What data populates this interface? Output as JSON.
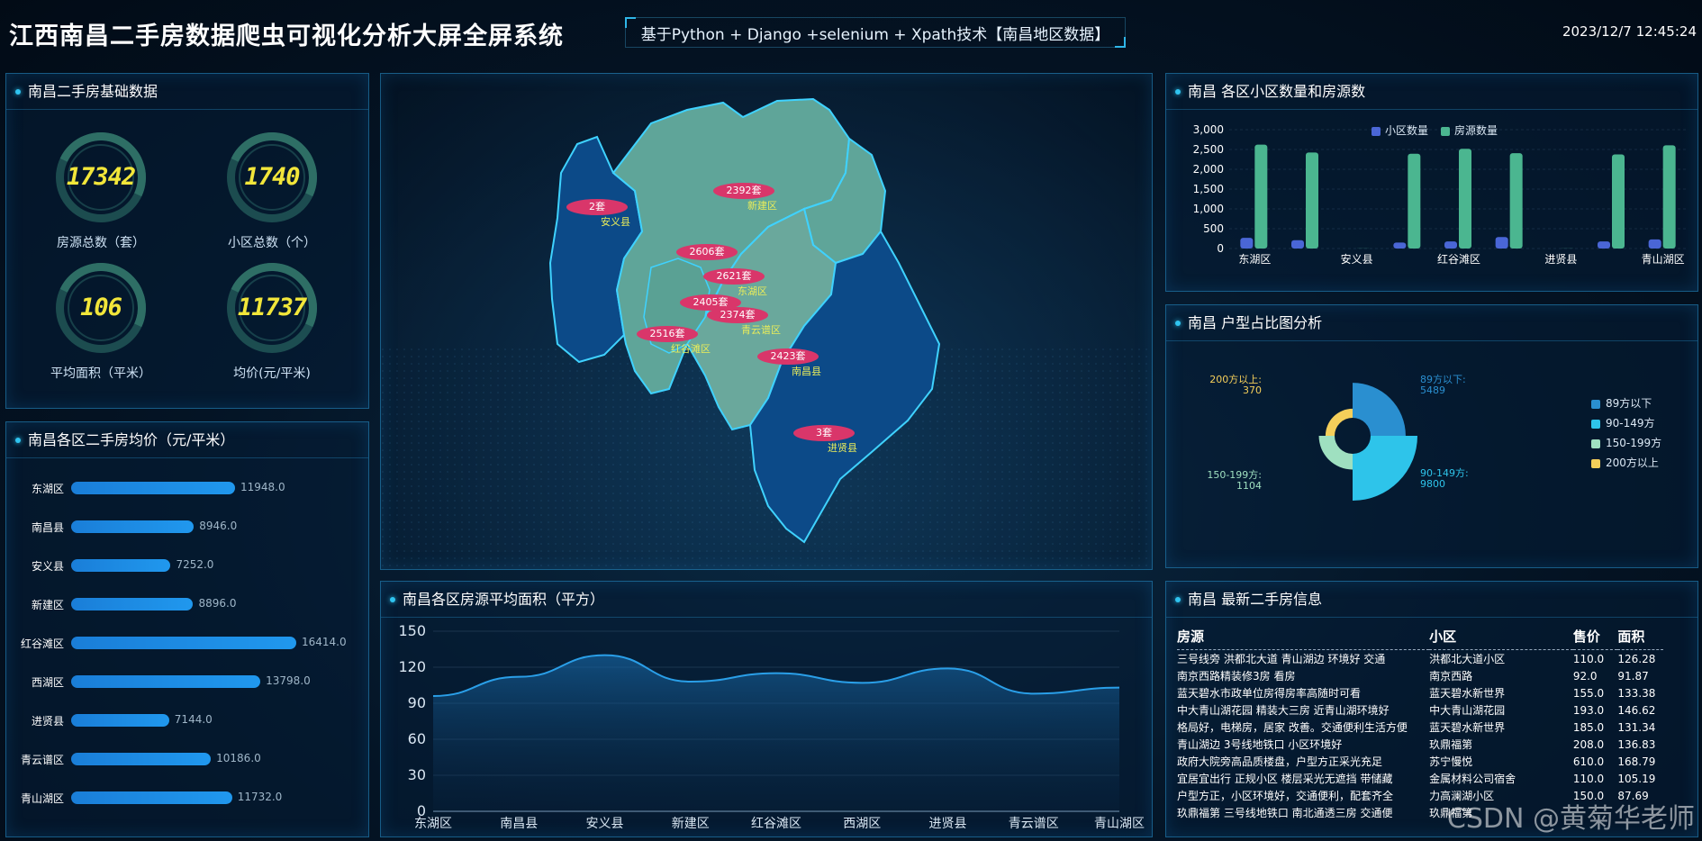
{
  "header": {
    "title": "江西南昌二手房数据爬虫可视化分析大屏全屏系统",
    "subtitle": "基于Python + Django +selenium + Xpath技术【南昌地区数据】",
    "datetime": "2023/12/7 12:45:24"
  },
  "basic": {
    "title": "南昌二手房基础数据",
    "stats": [
      {
        "value": "17342",
        "label": "房源总数（套）"
      },
      {
        "value": "1740",
        "label": "小区总数（个）"
      },
      {
        "value": "106",
        "label": "平均面积（平米）"
      },
      {
        "value": "11737",
        "label": "均价(元/平米)"
      }
    ]
  },
  "district_price": {
    "title": "南昌各区二手房均价（元/平米）",
    "rows": [
      {
        "name": "东湖区",
        "value": 11948.0,
        "label": "11948.0"
      },
      {
        "name": "南昌县",
        "value": 8946.0,
        "label": "8946.0"
      },
      {
        "name": "安义县",
        "value": 7252.0,
        "label": "7252.0"
      },
      {
        "name": "新建区",
        "value": 8896.0,
        "label": "8896.0"
      },
      {
        "name": "红谷滩区",
        "value": 16414.0,
        "label": "16414.0"
      },
      {
        "name": "西湖区",
        "value": 13798.0,
        "label": "13798.0"
      },
      {
        "name": "进贤县",
        "value": 7144.0,
        "label": "7144.0"
      },
      {
        "name": "青云谱区",
        "value": 10186.0,
        "label": "10186.0"
      },
      {
        "name": "青山湖区",
        "value": 11732.0,
        "label": "11732.0"
      }
    ]
  },
  "map": {
    "labels": [
      {
        "count": "2套",
        "name": "安义县"
      },
      {
        "count": "2392套",
        "name": "新建区"
      },
      {
        "count": "2606套",
        "name": ""
      },
      {
        "count": "2621套",
        "name": "东湖区"
      },
      {
        "count": "2405套",
        "name": ""
      },
      {
        "count": "2374套",
        "name": "青云谱区"
      },
      {
        "count": "2516套",
        "name": "红谷滩区"
      },
      {
        "count": "2423套",
        "name": "南昌县"
      },
      {
        "count": "3套",
        "name": "进贤县"
      }
    ]
  },
  "area_chart": {
    "title": "南昌各区房源平均面积（平方）"
  },
  "community_chart": {
    "title": "南昌 各区小区数量和房源数",
    "legend": [
      "小区数量",
      "房源数量"
    ],
    "x_labels_shown": [
      "东湖区",
      "安义县",
      "红谷滩区",
      "进贤县",
      "青山湖区"
    ]
  },
  "layout_chart": {
    "title": "南昌 户型占比图分析"
  },
  "latest": {
    "title": "南昌 最新二手房信息",
    "columns": [
      "房源",
      "小区",
      "售价",
      "面积"
    ],
    "rows": [
      [
        "三号线旁 洪都北大道 青山湖边 环境好 交通",
        "洪都北大道小区",
        "110.0",
        "126.28"
      ],
      [
        "南京西路精装修3房 看房",
        "南京西路",
        "92.0",
        "91.87"
      ],
      [
        "蓝天碧水市政单位房得房率高随时可看",
        "蓝天碧水新世界",
        "155.0",
        "133.38"
      ],
      [
        "中大青山湖花园 精装大三房 近青山湖环境好",
        "中大青山湖花园",
        "193.0",
        "146.62"
      ],
      [
        "格局好，电梯房，居家 改善。交通便利生活方便",
        "蓝天碧水新世界",
        "185.0",
        "131.34"
      ],
      [
        "青山湖边 3号线地铁口 小区环境好",
        "玖鼎福第",
        "208.0",
        "136.83"
      ],
      [
        "政府大院旁高品质楼盘，户型方正采光充足",
        "苏宁慢悦",
        "610.0",
        "168.79"
      ],
      [
        "宜居宜出行 正规小区 楼层采光无遮挡 带储藏",
        "金属材料公司宿舍",
        "110.0",
        "105.19"
      ],
      [
        "户型方正，小区环境好，交通便利，配套齐全",
        "力高澜湖小区",
        "150.0",
        "87.69"
      ],
      [
        "玖鼎福第 三号线地铁口 南北通透三房 交通便",
        "玖鼎福第",
        "",
        ""
      ]
    ]
  },
  "watermark": "CSDN @黄菊华老师",
  "chart_data": [
    {
      "type": "bar",
      "title": "南昌各区二手房均价（元/平米）",
      "categories": [
        "东湖区",
        "南昌县",
        "安义县",
        "新建区",
        "红谷滩区",
        "西湖区",
        "进贤县",
        "青云谱区",
        "青山湖区"
      ],
      "values": [
        11948.0,
        8946.0,
        7252.0,
        8896.0,
        16414.0,
        13798.0,
        7144.0,
        10186.0,
        11732.0
      ],
      "orientation": "horizontal"
    },
    {
      "type": "area",
      "title": "南昌各区房源平均面积（平方）",
      "categories": [
        "东湖区",
        "南昌县",
        "安义县",
        "新建区",
        "红谷滩区",
        "西湖区",
        "进贤县",
        "青云谱区",
        "青山湖区"
      ],
      "values": [
        96,
        112,
        130,
        108,
        115,
        107,
        119,
        98,
        103
      ],
      "ylim": [
        0,
        150
      ],
      "yticks": [
        0,
        30,
        60,
        90,
        120,
        150
      ]
    },
    {
      "type": "bar",
      "title": "南昌 各区小区数量和房源数",
      "categories": [
        "东湖区",
        "南昌县",
        "安义县",
        "新建区",
        "红谷滩区",
        "西湖区",
        "进贤县",
        "青云谱区",
        "青山湖区"
      ],
      "series": [
        {
          "name": "小区数量",
          "values": [
            270,
            210,
            0,
            150,
            180,
            290,
            0,
            180,
            230
          ]
        },
        {
          "name": "房源数量",
          "values": [
            2621,
            2423,
            2,
            2392,
            2516,
            2405,
            3,
            2374,
            2606
          ]
        }
      ],
      "ylim": [
        0,
        3000
      ],
      "yticks": [
        "0",
        "500",
        "1,000",
        "1,500",
        "2,000",
        "2,500",
        "3,000"
      ],
      "legend": "top-center"
    },
    {
      "type": "pie",
      "title": "南昌 户型占比图分析",
      "labels": [
        "89方以下",
        "90-149方",
        "150-199方",
        "200方以上"
      ],
      "values": [
        5489,
        9800,
        1104,
        370
      ],
      "colors": [
        "#2a8fd0",
        "#2ec4ea",
        "#9fe0c0",
        "#f5cf5a"
      ],
      "legend": "right"
    }
  ]
}
